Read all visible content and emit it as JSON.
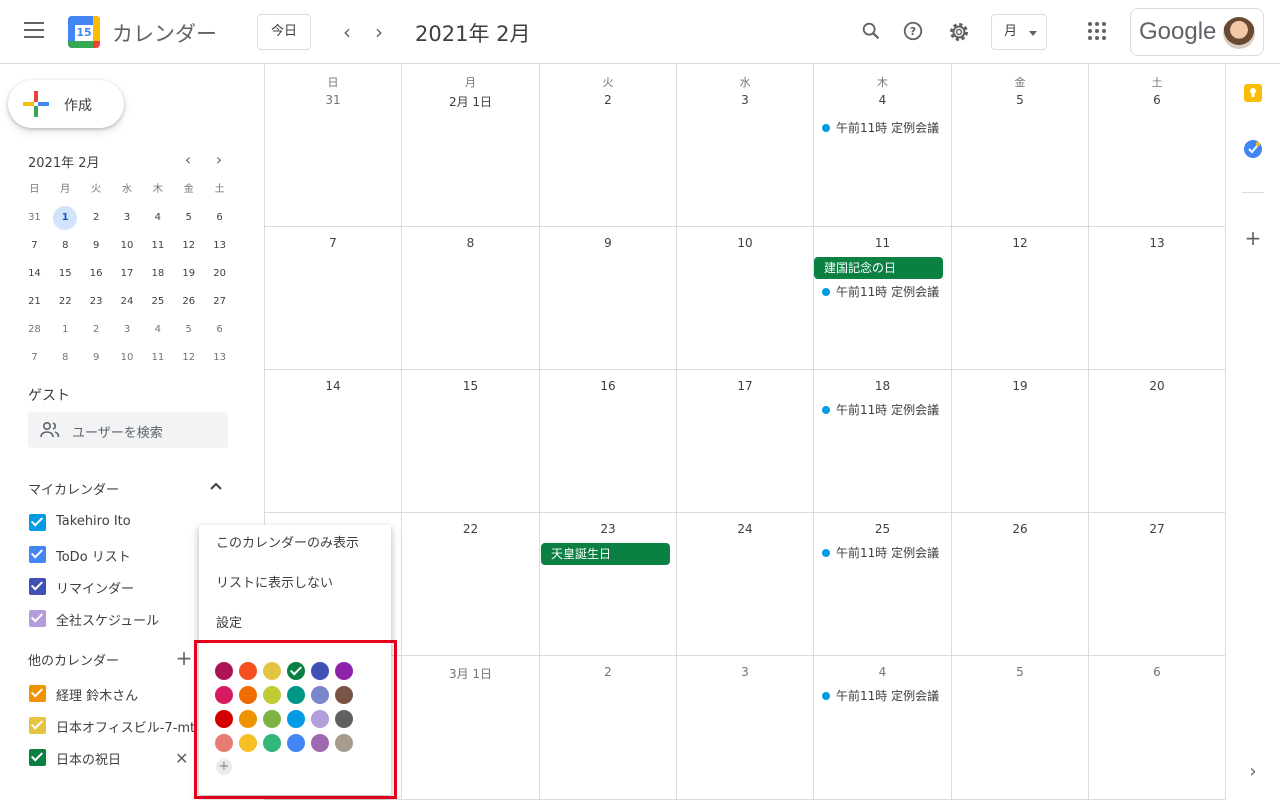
{
  "header": {
    "app_title": "カレンダー",
    "logo_day": "15",
    "today_label": "今日",
    "month_title": "2021年 2月",
    "view_label": "月",
    "google_label": "Google",
    "icons": [
      "menu-icon",
      "search-icon",
      "help-icon",
      "settings-icon",
      "apps-icon"
    ]
  },
  "sidebar": {
    "create_label": "作成",
    "mini_calendar": {
      "title": "2021年 2月",
      "weekdays": [
        "日",
        "月",
        "火",
        "水",
        "木",
        "金",
        "土"
      ],
      "weeks": [
        [
          "31",
          "1",
          "2",
          "3",
          "4",
          "5",
          "6"
        ],
        [
          "7",
          "8",
          "9",
          "10",
          "11",
          "12",
          "13"
        ],
        [
          "14",
          "15",
          "16",
          "17",
          "18",
          "19",
          "20"
        ],
        [
          "21",
          "22",
          "23",
          "24",
          "25",
          "26",
          "27"
        ],
        [
          "28",
          "1",
          "2",
          "3",
          "4",
          "5",
          "6"
        ],
        [
          "7",
          "8",
          "9",
          "10",
          "11",
          "12",
          "13"
        ]
      ],
      "selected": "1"
    },
    "guest_title": "ゲスト",
    "guest_placeholder": "ユーザーを検索",
    "my_calendars_title": "マイカレンダー",
    "my_calendars": [
      {
        "label": "Takehiro Ito",
        "color": "#039be5"
      },
      {
        "label": "ToDo リスト",
        "color": "#4285f4"
      },
      {
        "label": "リマインダー",
        "color": "#3f51b5"
      },
      {
        "label": "全社スケジュール",
        "color": "#b39ddb"
      }
    ],
    "other_calendars_title": "他のカレンダー",
    "other_calendars": [
      {
        "label": "経理 鈴木さん",
        "color": "#f09300"
      },
      {
        "label": "日本オフィスビル-7-mt",
        "color": "#e4c441"
      },
      {
        "label": "日本の祝日",
        "color": "#0b8043"
      }
    ]
  },
  "calendar": {
    "weekdays": [
      "日",
      "月",
      "火",
      "水",
      "木",
      "金",
      "土"
    ],
    "weeks": [
      [
        "31",
        "2月 1日",
        "2",
        "3",
        "4",
        "5",
        "6"
      ],
      [
        "7",
        "8",
        "9",
        "10",
        "11",
        "12",
        "13"
      ],
      [
        "14",
        "15",
        "16",
        "17",
        "18",
        "19",
        "20"
      ],
      [
        "",
        "22",
        "23",
        "24",
        "25",
        "26",
        "27"
      ],
      [
        "",
        "3月 1日",
        "2",
        "3",
        "4",
        "5",
        "6"
      ]
    ],
    "events": {
      "meeting": "午前11時 定例会議",
      "holiday_11": "建国記念の日",
      "holiday_23": "天皇誕生日"
    }
  },
  "context_menu": {
    "items": [
      "このカレンダーのみ表示",
      "リストに表示しない",
      "設定"
    ],
    "colors": [
      [
        "#ad1457",
        "#f4511e",
        "#e4c441",
        "#0b8043",
        "#3f51b5",
        "#8e24aa"
      ],
      [
        "#d81b60",
        "#ef6c00",
        "#c0ca33",
        "#009688",
        "#7986cb",
        "#795548"
      ],
      [
        "#d50000",
        "#f09300",
        "#7cb342",
        "#039be5",
        "#b39ddb",
        "#616161"
      ],
      [
        "#e67c73",
        "#f6bf26",
        "#33b679",
        "#4285f4",
        "#9e69af",
        "#a79b8e"
      ]
    ],
    "selected_color": "#0b8043",
    "add_label": "+"
  }
}
